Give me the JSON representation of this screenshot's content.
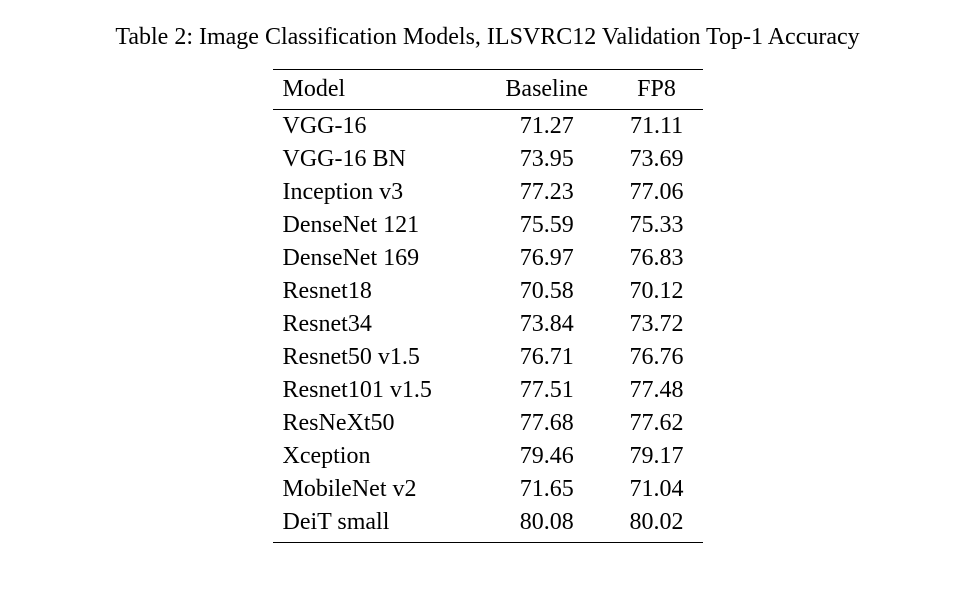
{
  "caption": "Table 2: Image Classification Models, ILSVRC12 Validation Top-1 Accuracy",
  "columns": [
    "Model",
    "Baseline",
    "FP8"
  ],
  "rows": [
    {
      "name": "VGG-16",
      "baseline": "71.27",
      "fp8": "71.11"
    },
    {
      "name": "VGG-16 BN",
      "baseline": "73.95",
      "fp8": "73.69"
    },
    {
      "name": "Inception v3",
      "baseline": "77.23",
      "fp8": "77.06"
    },
    {
      "name": "DenseNet 121",
      "baseline": "75.59",
      "fp8": "75.33"
    },
    {
      "name": "DenseNet 169",
      "baseline": "76.97",
      "fp8": "76.83"
    },
    {
      "name": "Resnet18",
      "baseline": "70.58",
      "fp8": "70.12"
    },
    {
      "name": "Resnet34",
      "baseline": "73.84",
      "fp8": "73.72"
    },
    {
      "name": "Resnet50 v1.5",
      "baseline": "76.71",
      "fp8": "76.76"
    },
    {
      "name": "Resnet101 v1.5",
      "baseline": "77.51",
      "fp8": "77.48"
    },
    {
      "name": "ResNeXt50",
      "baseline": "77.68",
      "fp8": "77.62"
    },
    {
      "name": "Xception",
      "baseline": "79.46",
      "fp8": "79.17"
    },
    {
      "name": "MobileNet v2",
      "baseline": "71.65",
      "fp8": "71.04"
    },
    {
      "name": "DeiT small",
      "baseline": "80.08",
      "fp8": "80.02"
    }
  ],
  "chart_data": {
    "type": "table",
    "title": "Image Classification Models, ILSVRC12 Validation Top-1 Accuracy",
    "columns": [
      "Model",
      "Baseline",
      "FP8"
    ],
    "rows": [
      [
        "VGG-16",
        71.27,
        71.11
      ],
      [
        "VGG-16 BN",
        73.95,
        73.69
      ],
      [
        "Inception v3",
        77.23,
        77.06
      ],
      [
        "DenseNet 121",
        75.59,
        75.33
      ],
      [
        "DenseNet 169",
        76.97,
        76.83
      ],
      [
        "Resnet18",
        70.58,
        70.12
      ],
      [
        "Resnet34",
        73.84,
        73.72
      ],
      [
        "Resnet50 v1.5",
        76.71,
        76.76
      ],
      [
        "Resnet101 v1.5",
        77.51,
        77.48
      ],
      [
        "ResNeXt50",
        77.68,
        77.62
      ],
      [
        "Xception",
        79.46,
        79.17
      ],
      [
        "MobileNet v2",
        71.65,
        71.04
      ],
      [
        "DeiT small",
        80.08,
        80.02
      ]
    ]
  }
}
